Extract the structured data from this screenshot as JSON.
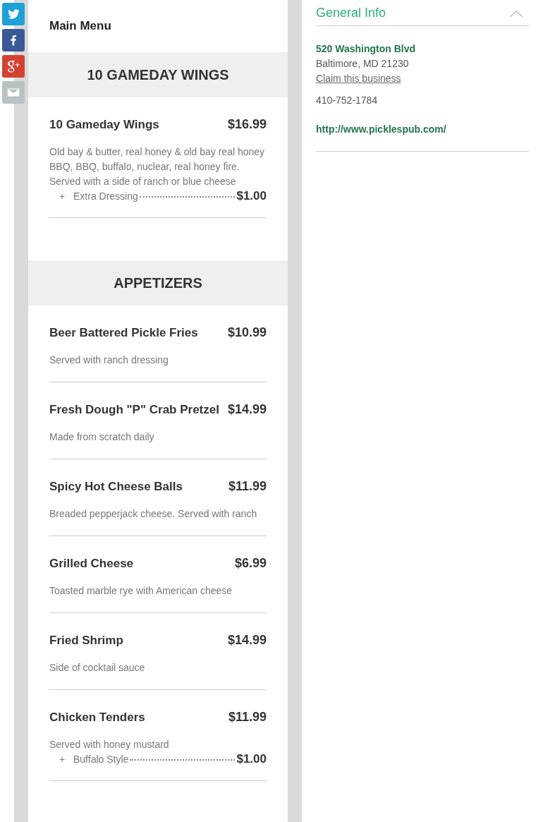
{
  "menu_title": "Main Menu",
  "sections": [
    {
      "title": "10 GAMEDAY WINGS",
      "items": [
        {
          "name": "10 Gameday Wings",
          "price": "$16.99",
          "description": "Old bay & butter, real honey & old bay real honey BBQ, BBQ, buffalo, nuclear, real honey fire. Served with a side of ranch or blue cheese",
          "options": [
            {
              "bullet": "+",
              "name": "Extra Dressing",
              "price": "$1.00"
            }
          ]
        }
      ]
    },
    {
      "title": "APPETIZERS",
      "items": [
        {
          "name": "Beer Battered Pickle Fries",
          "price": "$10.99",
          "description": "Served with ranch dressing"
        },
        {
          "name": "Fresh Dough \"P\" Crab Pretzel",
          "price": "$14.99",
          "description": "Made from scratch daily"
        },
        {
          "name": "Spicy Hot Cheese Balls",
          "price": "$11.99",
          "description": "Breaded pepperjack cheese. Served with ranch"
        },
        {
          "name": "Grilled Cheese",
          "price": "$6.99",
          "description": "Toasted marble rye with American cheese"
        },
        {
          "name": "Fried Shrimp",
          "price": "$14.99",
          "description": "Side of cocktail sauce"
        },
        {
          "name": "Chicken Tenders",
          "price": "$11.99",
          "description": "Served with honey mustard",
          "options": [
            {
              "bullet": "+",
              "name": "Buffalo Style",
              "price": "$1.00"
            }
          ]
        }
      ]
    }
  ],
  "share_buttons": [
    {
      "kind": "twitter",
      "color": "#1da1d6"
    },
    {
      "kind": "facebook",
      "color": "#3b5998"
    },
    {
      "kind": "googleplus",
      "color": "#d44132"
    },
    {
      "kind": "email",
      "color": "#b8c2c4"
    }
  ],
  "info": {
    "title": "General Info",
    "street": "520 Washington Blvd",
    "city": "Baltimore, MD 21230",
    "claim_link": "Claim this business",
    "phone": "410-752-1784",
    "website": "http://www.picklespub.com/"
  }
}
